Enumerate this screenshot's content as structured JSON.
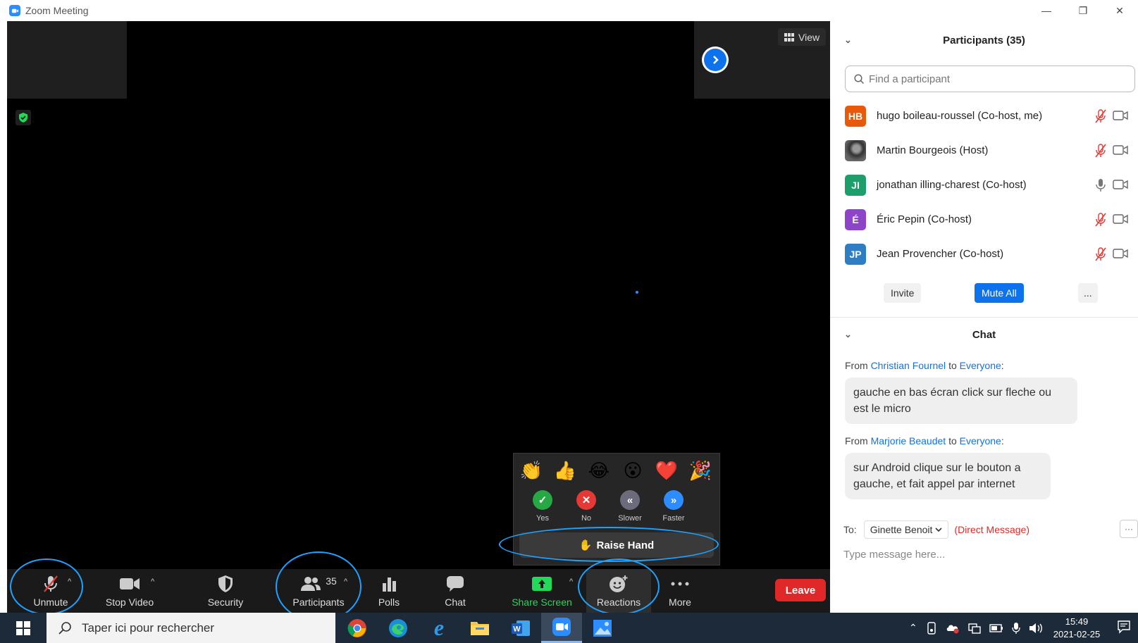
{
  "window": {
    "title": "Zoom Meeting",
    "minimize": "—",
    "restore": "❐",
    "close": "✕"
  },
  "video": {
    "view_label": "View"
  },
  "reactions_popup": {
    "emojis": [
      "👏",
      "👍",
      "😂",
      "😮",
      "❤️",
      "🎉"
    ],
    "feedback": [
      {
        "label": "Yes",
        "symbol": "✓",
        "color": "#27A844"
      },
      {
        "label": "No",
        "symbol": "✕",
        "color": "#E53935"
      },
      {
        "label": "Slower",
        "symbol": "«",
        "color": "#6B6B7B"
      },
      {
        "label": "Faster",
        "symbol": "»",
        "color": "#2D8CFF"
      }
    ],
    "raise_hand_label": "Raise Hand",
    "raise_hand_emoji": "✋"
  },
  "toolbar": {
    "unmute": "Unmute",
    "stop_video": "Stop Video",
    "security": "Security",
    "participants": "Participants",
    "participants_count": "35",
    "polls": "Polls",
    "chat": "Chat",
    "share_screen": "Share Screen",
    "reactions": "Reactions",
    "more": "More",
    "leave": "Leave",
    "caret": "^"
  },
  "participants_panel": {
    "title": "Participants (35)",
    "search_placeholder": "Find a participant",
    "participants": [
      {
        "initials": "HB",
        "name": "hugo boileau-roussel (Co-host, me)",
        "color": "#E8590C",
        "muted": true
      },
      {
        "initials": "",
        "name": "Martin Bourgeois (Host)",
        "color": "#444444",
        "muted": true
      },
      {
        "initials": "JI",
        "name": "jonathan illing-charest (Co-host)",
        "color": "#1E9E6A",
        "muted": false
      },
      {
        "initials": "É",
        "name": "Éric Pepin (Co-host)",
        "color": "#8E44C9",
        "muted": true
      },
      {
        "initials": "JP",
        "name": "Jean Provencher (Co-host)",
        "color": "#2E7EC4",
        "muted": true
      }
    ],
    "invite": "Invite",
    "mute_all": "Mute All",
    "more": "..."
  },
  "chat_panel": {
    "title": "Chat",
    "messages": [
      {
        "from_label": "From",
        "sender": "Christian Fournel",
        "to_label": "to",
        "recipient": "Everyone",
        "text": "gauche en bas écran click sur fleche ou est le micro"
      },
      {
        "from_label": "From",
        "sender": "Marjorie Beaudet",
        "to_label": "to",
        "recipient": "Everyone",
        "text": "sur Android clique sur le bouton a gauche, et fait appel par internet"
      }
    ],
    "to_label": "To:",
    "to_recipient": "Ginette Benoit",
    "direct_message": "(Direct Message)",
    "input_placeholder": "Type message here...",
    "more": "···"
  },
  "taskbar": {
    "search_placeholder": "Taper ici pour rechercher",
    "time": "15:49",
    "date": "2021-02-25"
  },
  "colors": {
    "accent": "#2D8CFF",
    "leave": "#E02828",
    "share": "#23D959",
    "annotation": "#1EA2FF"
  }
}
